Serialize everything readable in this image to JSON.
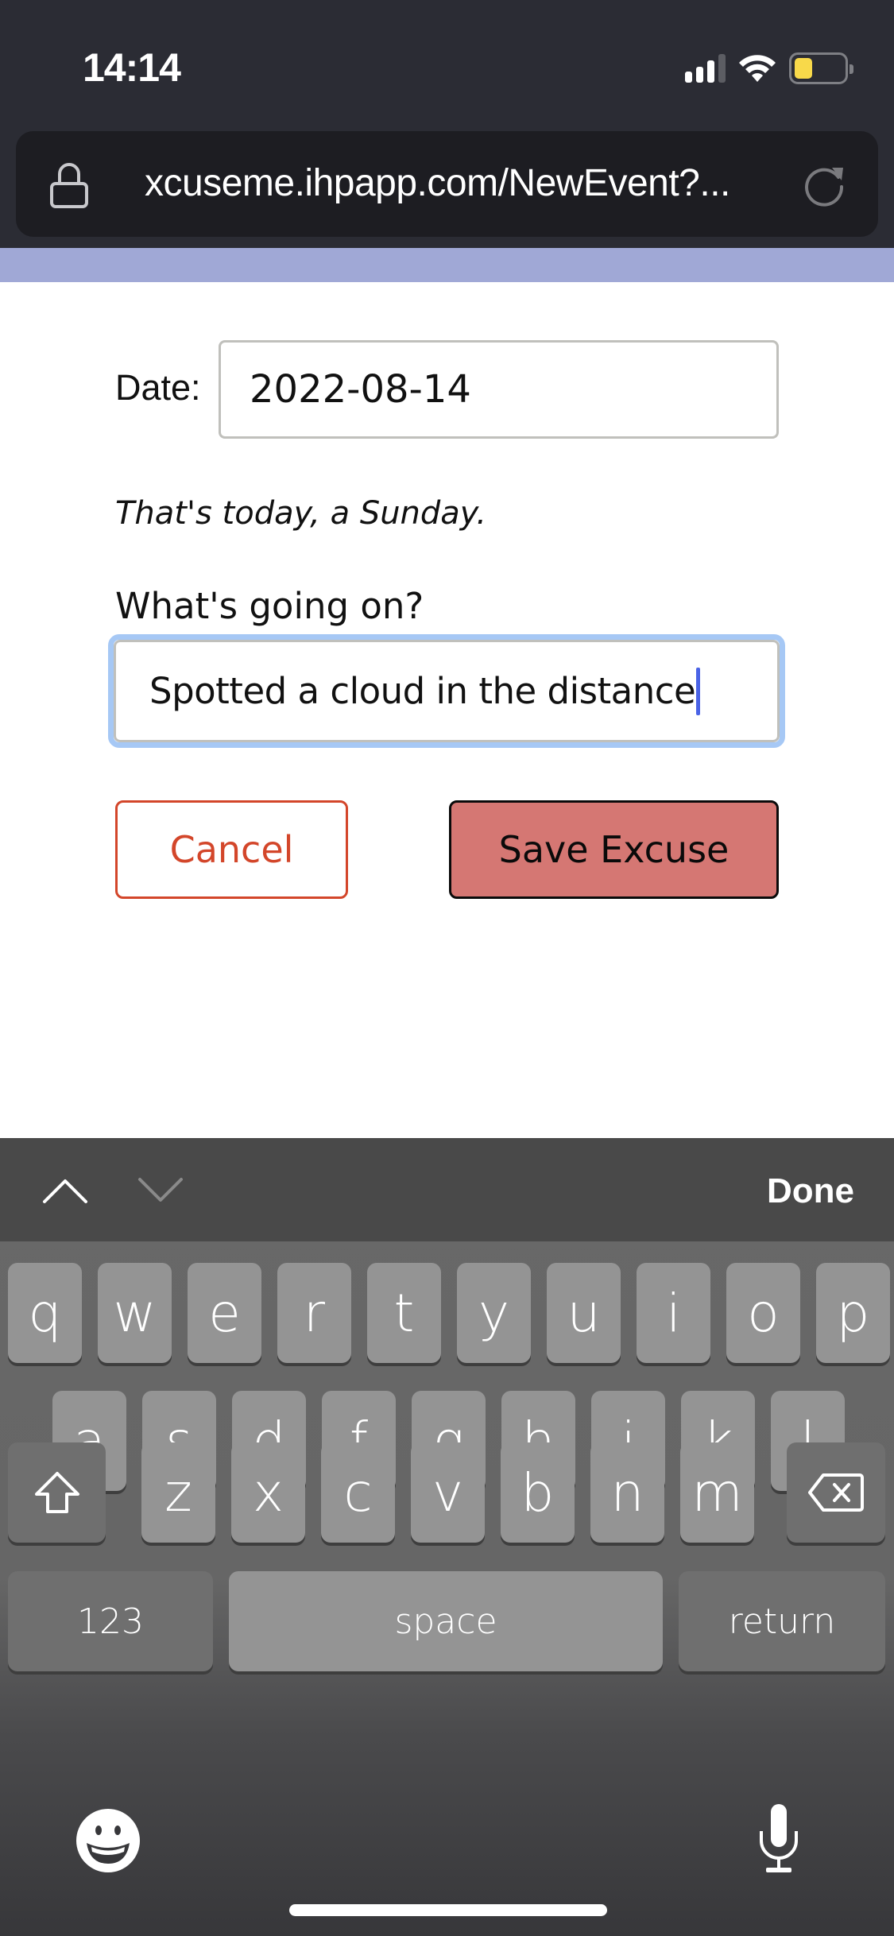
{
  "status_bar": {
    "time": "14:14",
    "signal_bars": 3,
    "signal_bars_total": 4,
    "battery_level": 0.3,
    "battery_color": "#f8d94a",
    "icons": [
      "cellular-signal-icon",
      "wifi-icon",
      "battery-icon"
    ]
  },
  "browser": {
    "url": "xcuseme.ihpapp.com/NewEvent?...",
    "icons": [
      "lock-icon",
      "reload-icon"
    ]
  },
  "form": {
    "date_label": "Date:",
    "date_value": "2022-08-14",
    "date_note": "That's today, a Sunday.",
    "description_label": "What's going on?",
    "description_value": "Spotted a cloud in the distance",
    "cancel_label": "Cancel",
    "save_label": "Save Excuse",
    "colors": {
      "cancel": "#d3462a",
      "save_bg": "#d57773",
      "focus_ring": "#a6c8f5",
      "header_strip": "#a0a8d6"
    }
  },
  "keyboard": {
    "accessory": {
      "prev_icon": "chevron-up-icon",
      "next_icon": "chevron-down-icon",
      "done_label": "Done"
    },
    "row1": [
      "q",
      "w",
      "e",
      "r",
      "t",
      "y",
      "u",
      "i",
      "o",
      "p"
    ],
    "row2": [
      "a",
      "s",
      "d",
      "f",
      "g",
      "h",
      "j",
      "k",
      "l"
    ],
    "row3": [
      "z",
      "x",
      "c",
      "v",
      "b",
      "n",
      "m"
    ],
    "numbers_label": "123",
    "space_label": "space",
    "return_label": "return",
    "icons": [
      "shift-icon",
      "backspace-icon",
      "emoji-icon",
      "microphone-icon"
    ]
  }
}
